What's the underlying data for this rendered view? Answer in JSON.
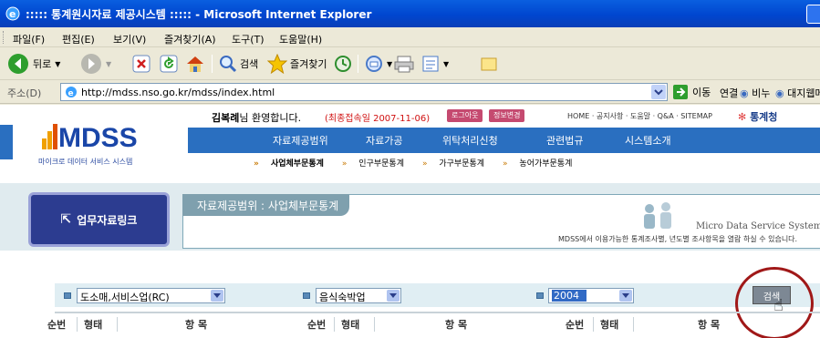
{
  "window": {
    "title": "::::: 통계원시자료 제공시스템 ::::: - Microsoft Internet Explorer"
  },
  "menu": [
    "파일(F)",
    "편집(E)",
    "보기(V)",
    "즐겨찾기(A)",
    "도구(T)",
    "도움말(H)"
  ],
  "toolbar": {
    "back": "뒤로",
    "search": "검색",
    "favorites": "즐겨찾기"
  },
  "address": {
    "label": "주소(D)",
    "url": "http://mdss.nso.go.kr/mdss/index.html",
    "go": "이동",
    "links_label": "연결",
    "link1": "비누",
    "link2": "대지웹메일"
  },
  "site": {
    "logo": "MDSS",
    "logo_sub": "마이크로 데이터 서비스 시스템",
    "welcome_name": "김복례",
    "welcome_suffix": "님 환영합니다.",
    "last_login": "(최종접속일 2007-11-06)",
    "logout": "로그아웃",
    "info_change": "정보변경",
    "top_links": "HOME · 공지사항 · 도움말 · Q&A · SITEMAP",
    "brand": "통계청",
    "nav": [
      "자료제공범위",
      "자료가공",
      "위탁처리신청",
      "관련법규",
      "시스템소개"
    ],
    "subnav": [
      "사업체부문통계",
      "인구부문통계",
      "가구부문통계",
      "농어가부문통계"
    ],
    "link_button": "업무자료링크",
    "scope_title": "자료제공범위 : 사업체부문통계",
    "mds_system": "Micro Data Service System",
    "mds_desc": "MDSS에서 이용가능한 통계조사별, 년도별 조사항목을 열람 하실 수 있습니다."
  },
  "filters": {
    "category": "도소매,서비스업(RC)",
    "subcategory": "음식숙박업",
    "year": "2004",
    "search": "검색"
  },
  "table_headers": {
    "seq": "순번",
    "type": "형태",
    "item": "항 목"
  },
  "colors": {
    "nav": "#2a6fc0",
    "accent": "#f0a000",
    "annotation": "#a01818"
  }
}
